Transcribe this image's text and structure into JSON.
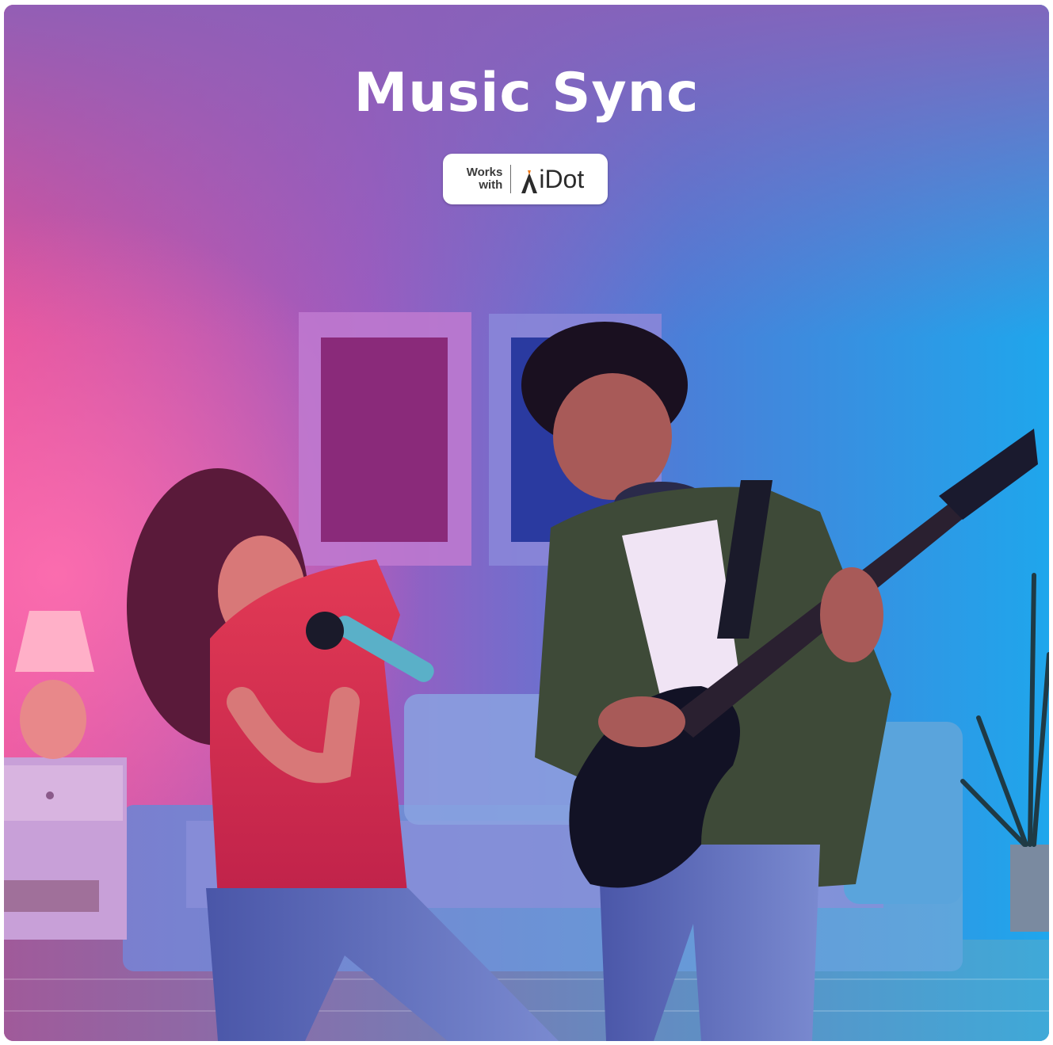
{
  "title": "Music Sync",
  "badge": {
    "works_line1": "Works",
    "works_line2": "with",
    "brand_name": "iDot",
    "brand_accent_color": "#f07a1a"
  },
  "colors": {
    "background_left": "#d0458f",
    "background_right": "#2a95e2"
  }
}
